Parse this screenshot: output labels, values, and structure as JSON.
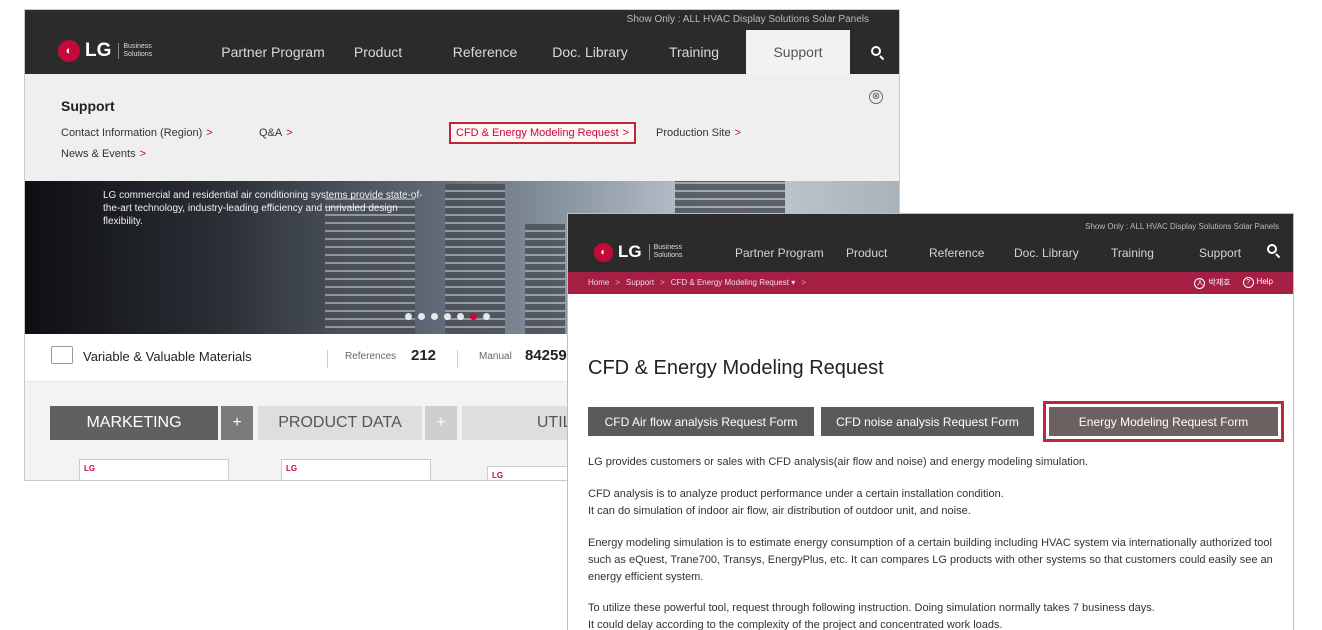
{
  "window_a": {
    "show_only": "Show Only :  ALL  HVAC  Display Solutions  Solar Panels",
    "logo_text": "LG",
    "logo_sub": "Business Solutions",
    "nav": [
      "Partner Program",
      "Product",
      "Reference",
      "Doc. Library",
      "Training",
      "Support"
    ],
    "support_title": "Support",
    "links": {
      "contact": "Contact Information (Region)",
      "qa": "Q&A",
      "cfd": "CFD & Energy Modeling Request",
      "production": "Production Site",
      "news": "News & Events"
    },
    "chevron": ">",
    "close_glyph": "⊗",
    "hero_text": "LG commercial and residential air conditioning systems provide state-of-the-art technology, industry-leading efficiency and unrivaled design flexibility.",
    "stats": {
      "title": "Variable & Valuable Materials",
      "references_label": "References",
      "references_value": "212",
      "manual_label": "Manual",
      "manual_value": "84259"
    },
    "tabs": {
      "marketing": "MARKETING",
      "product_data": "PRODUCT DATA",
      "utility": "UTILI",
      "plus": "+"
    },
    "card_logo": "LG"
  },
  "window_b": {
    "show_only": "Show Only :  ALL  HVAC  Display Solutions  Solar Panels",
    "logo_text": "LG",
    "logo_sub": "Business Solutions",
    "nav": [
      "Partner Program",
      "Product",
      "Reference",
      "Doc. Library",
      "Training",
      "Support"
    ],
    "breadcrumb": [
      "Home",
      "Support",
      "CFD & Energy Modeling Request ▾"
    ],
    "user_name": "박재호",
    "help": "Help",
    "page_title": "CFD & Energy Modeling Request",
    "buttons": {
      "airflow": "CFD Air flow analysis Request Form",
      "noise": "CFD noise analysis Request Form",
      "energy": "Energy Modeling Request Form"
    },
    "paragraphs": [
      "LG provides customers or sales with CFD analysis(air flow and noise) and energy modeling simulation.",
      "CFD analysis is to analyze product performance under a certain installation condition.",
      "It can do simulation of indoor air flow, air distribution of outdoor unit, and noise.",
      "Energy modeling simulation is to estimate energy consumption of a certain building including HVAC system via internationally authorized tool such as eQuest, Trane700, Transys, EnergyPlus, etc. It can compares LG products with other systems so that customers could easily see an energy efficient system.",
      "To utilize these powerful tool, request through following instruction. Doing simulation normally takes 7 business days.",
      "It could delay according to the complexity of the project and concentrated work loads."
    ]
  },
  "colors": {
    "brand_red": "#c6093b",
    "nav_dark": "#2b2b2b",
    "breadcrumb_bar": "#a51f45",
    "highlight_box": "#c0263a",
    "button_gray": "#5a5a5a"
  }
}
